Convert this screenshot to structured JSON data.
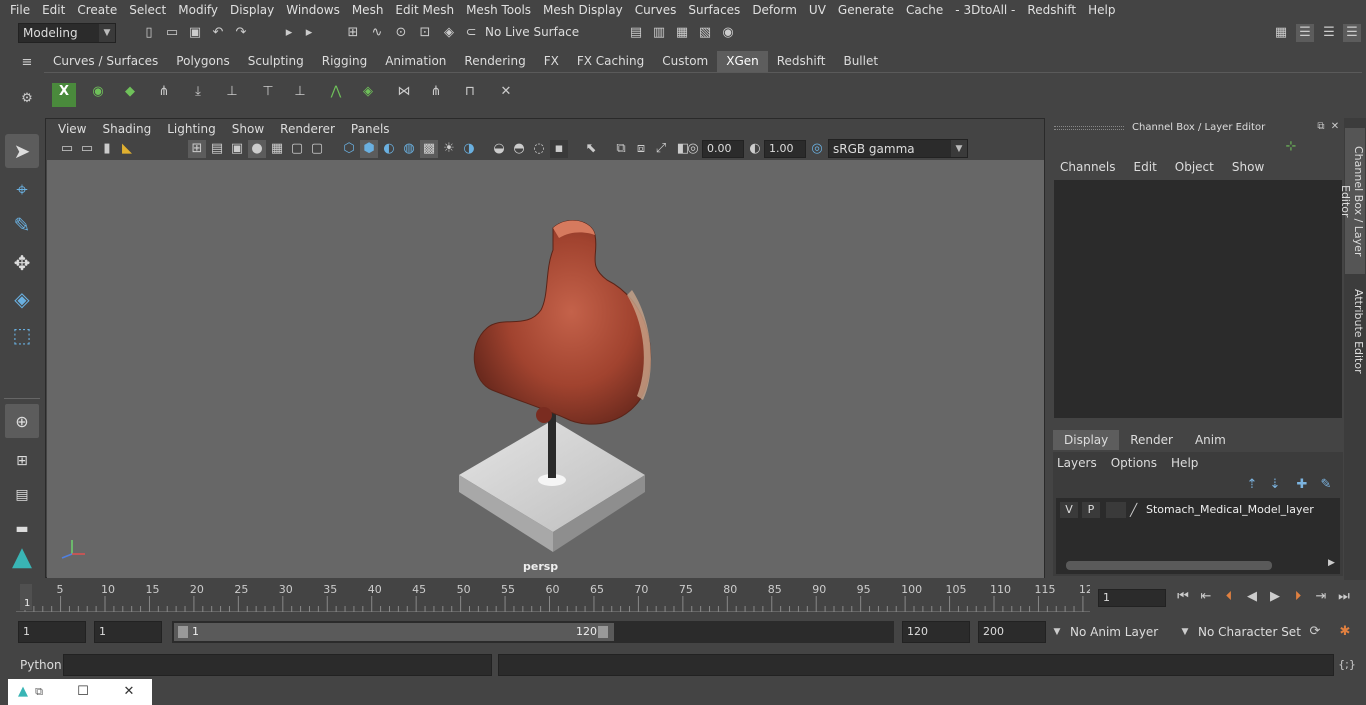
{
  "menubar": {
    "items": [
      "File",
      "Edit",
      "Create",
      "Select",
      "Modify",
      "Display",
      "Windows",
      "Mesh",
      "Edit Mesh",
      "Mesh Tools",
      "Mesh Display",
      "Curves",
      "Surfaces",
      "Deform",
      "UV",
      "Generate",
      "Cache",
      "- 3DtoAll -",
      "Redshift",
      "Help"
    ]
  },
  "statusline": {
    "mode": "Modeling",
    "live_surface": "No Live Surface"
  },
  "shelf": {
    "tabs": [
      "Curves / Surfaces",
      "Polygons",
      "Sculpting",
      "Rigging",
      "Animation",
      "Rendering",
      "FX",
      "FX Caching",
      "Custom",
      "XGen",
      "Redshift",
      "Bullet"
    ],
    "active_tab": "XGen"
  },
  "viewport": {
    "menu": [
      "View",
      "Shading",
      "Lighting",
      "Show",
      "Renderer",
      "Panels"
    ],
    "exposure": "0.00",
    "gamma": "1.00",
    "color_space": "sRGB gamma",
    "camera_label": "persp"
  },
  "channel_box": {
    "title": "Channel Box / Layer Editor",
    "menu": [
      "Channels",
      "Edit",
      "Object",
      "Show"
    ],
    "side_tabs": [
      "Channel Box / Layer Editor",
      "Attribute Editor"
    ],
    "layer_tabs": [
      "Display",
      "Render",
      "Anim"
    ],
    "active_layer_tab": "Display",
    "layer_menu": [
      "Layers",
      "Options",
      "Help"
    ],
    "layer": {
      "v": "V",
      "p": "P",
      "name": "Stomach_Medical_Model_layer"
    }
  },
  "timeline": {
    "ticks": [
      "5",
      "10",
      "15",
      "20",
      "25",
      "30",
      "35",
      "40",
      "45",
      "50",
      "55",
      "60",
      "65",
      "70",
      "75",
      "80",
      "85",
      "90",
      "95",
      "100",
      "105",
      "110",
      "115",
      "12"
    ],
    "first_tick": "1",
    "current_frame": "1"
  },
  "range": {
    "start": "1",
    "playback_start": "1",
    "slider_start": "1",
    "slider_end": "120",
    "playback_end": "120",
    "end": "200",
    "anim_layer": "No Anim Layer",
    "character_set": "No Character Set"
  },
  "cmdline": {
    "label": "Python"
  },
  "colors": {
    "accent": "#5285a6",
    "background": "#444444",
    "viewport": "#676767"
  }
}
